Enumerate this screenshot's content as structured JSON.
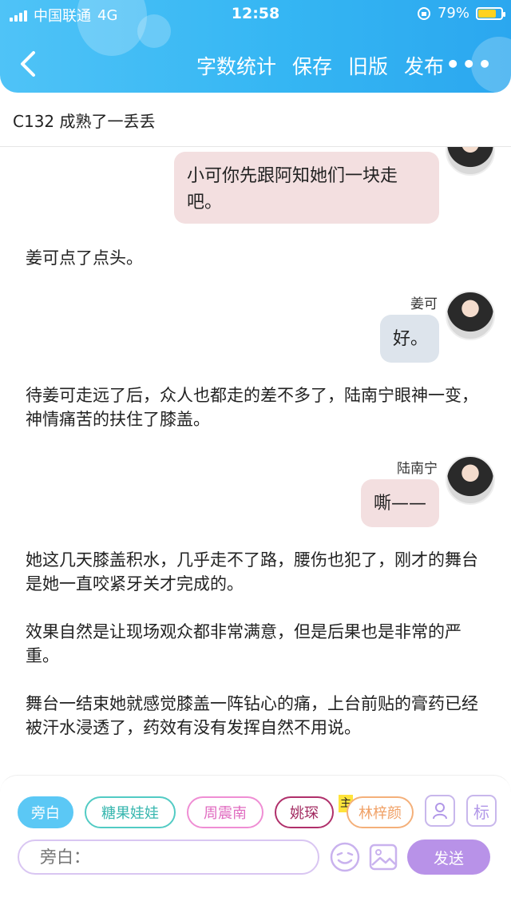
{
  "status_bar": {
    "carrier": "中国联通",
    "network": "4G",
    "time": "12:58",
    "battery_text": "79%",
    "battery_level": 0.79
  },
  "toolbar": {
    "word_count": "字数统计",
    "save": "保存",
    "old_version": "旧版",
    "publish": "发布",
    "more": "•••"
  },
  "chapter": {
    "title": "C132  成熟了一丢丢"
  },
  "story": {
    "line1": "小可你先跟阿知她们一块走吧。",
    "para1": "姜可点了点头。",
    "speaker2": "姜可",
    "line2": "好。",
    "para2": "待姜可走远了后，众人也都走的差不多了，陆南宁眼神一变，神情痛苦的扶住了膝盖。",
    "speaker3": "陆南宁",
    "line3": "嘶——",
    "para3": "她这几天膝盖积水，几乎走不了路，腰伤也犯了，刚才的舞台是她一直咬紧牙关才完成的。",
    "para4": "效果自然是让现场观众都非常满意，但是后果也是非常的严重。",
    "para5": "舞台一结束她就感觉膝盖一阵钻心的痛，上台前贴的膏药已经被汗水浸透了，药效有没有发挥自然不用说。"
  },
  "roles": {
    "narration": "旁白",
    "r1": "糖果娃娃",
    "r2": "周震南",
    "r3": "姚琛",
    "main_tag": "主",
    "r4": "林梓颜",
    "tag_icon_label": "标"
  },
  "composer": {
    "placeholder": "旁白：",
    "send": "发送"
  },
  "colors": {
    "header": "#35b6f3",
    "bubble_pink": "#f3dfe0",
    "bubble_grey": "#dde4ec",
    "narration_chip": "#5bc8f5",
    "send_button": "#b892e8"
  }
}
